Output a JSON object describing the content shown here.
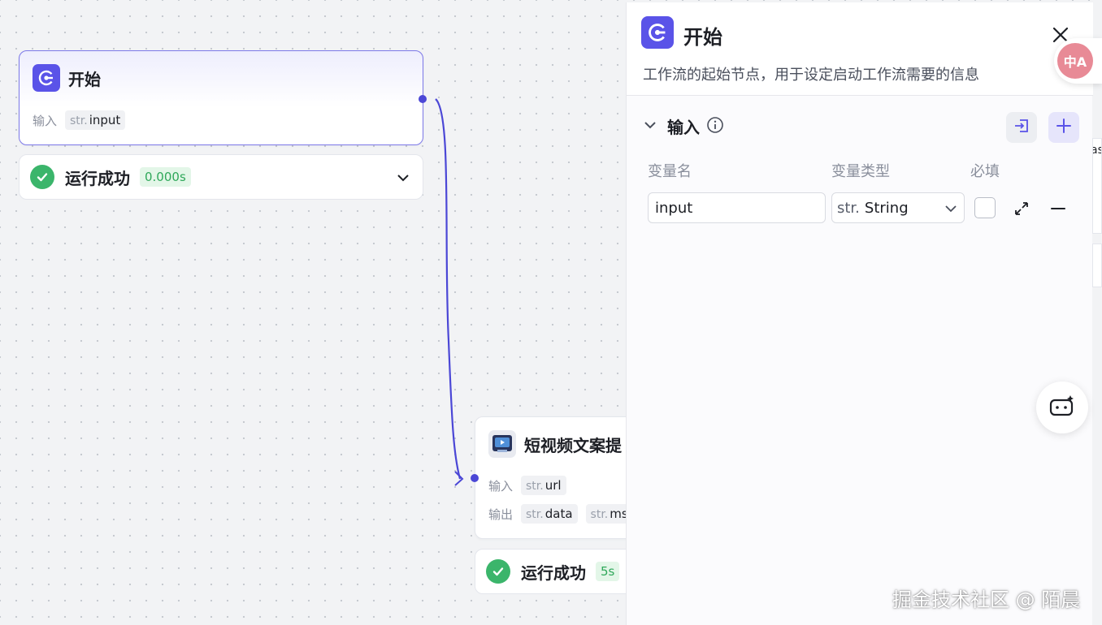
{
  "canvas": {
    "start_node": {
      "title": "开始",
      "input_label": "输入",
      "input_type": "str.",
      "input_var": "input"
    },
    "start_status": {
      "text": "运行成功",
      "time": "0.000s"
    },
    "video_node": {
      "title": "短视频文案提",
      "input_label": "输入",
      "output_label": "输出",
      "inputs": [
        {
          "type": "str.",
          "name": "url"
        }
      ],
      "outputs": [
        {
          "type": "str.",
          "name": "data"
        },
        {
          "type": "str.",
          "name": "ms"
        }
      ]
    },
    "video_status": {
      "text": "运行成功",
      "time": "5s"
    }
  },
  "panel": {
    "title": "开始",
    "description": "工作流的起始节点，用于设定启动工作流需要的信息",
    "section_title": "输入",
    "columns": {
      "name": "变量名",
      "type": "变量类型",
      "required": "必填"
    },
    "variable": {
      "name": "input",
      "type_prefix": "str.",
      "type": "String",
      "required": false
    }
  },
  "floating": {
    "translate_label": "中A"
  },
  "edge_fragment_text": "as",
  "watermark": "掘金技术社区 @ 陌晨",
  "colors": {
    "brand": "#5a53e8",
    "success": "#3bb56b",
    "edge": "#4b47d6"
  },
  "icons": [
    "start-node-icon",
    "check-icon",
    "chevron-down-icon",
    "close-icon",
    "info-icon",
    "import-icon",
    "plus-icon",
    "expand-icon",
    "minus-icon",
    "translate-icon",
    "ai-bot-icon",
    "video-plugin-icon"
  ]
}
